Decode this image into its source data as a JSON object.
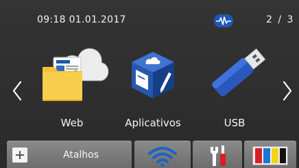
{
  "status": {
    "datetime": "09:18  01.01.2017",
    "wifi_status_icon": "wireless-direct-icon",
    "page_indicator": "2 / 3"
  },
  "navigation": {
    "previous_icon": "chevron-left-icon",
    "next_icon": "chevron-right-icon"
  },
  "tiles": [
    {
      "label": "Web",
      "icon": "web-folder-cloud-icon"
    },
    {
      "label": "Aplicativos",
      "icon": "apps-cube-icon"
    },
    {
      "label": "USB",
      "icon": "usb-drive-icon"
    }
  ],
  "bottom_bar": {
    "shortcuts_label": "Atalhos",
    "shortcuts_icon": "plus-icon",
    "wifi_icon": "wifi-icon",
    "tools_icon": "tools-icon",
    "ink_icon": "ink-cartridges-icon",
    "ink_colors": [
      "#d61f26",
      "#1f74d6",
      "#f2d21a",
      "#111111"
    ]
  },
  "colors": {
    "background": "#2f2f2f",
    "accent": "#1f57b6",
    "button": "#7b7b7b"
  }
}
